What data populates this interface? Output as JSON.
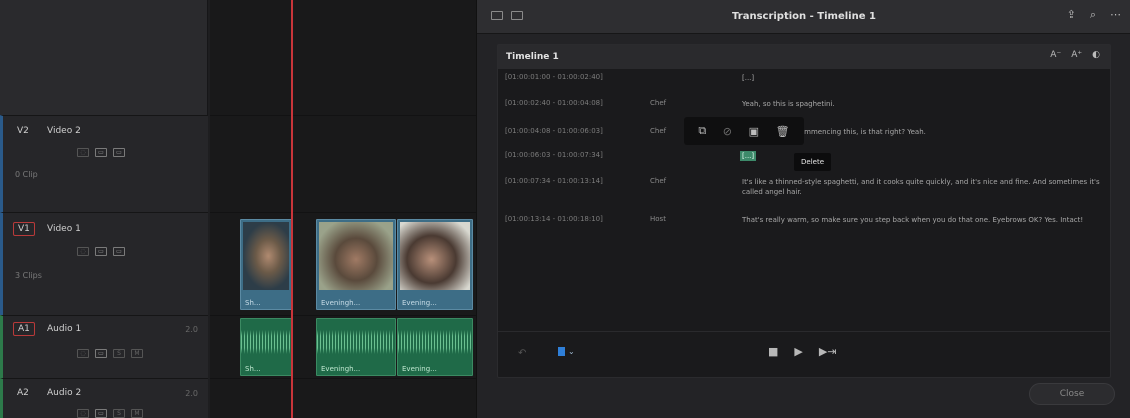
{
  "window": {
    "title": "Transcription - Timeline 1",
    "close_label": "Close"
  },
  "panel": {
    "title": "Timeline 1",
    "icons": [
      "font-smaller-icon",
      "font-larger-icon",
      "contrast-icon"
    ]
  },
  "transcript": [
    {
      "timecode": "[01:00:01:00 - 01:00:02:40]",
      "speaker": "",
      "text": "[...]",
      "highlighted": false
    },
    {
      "timecode": "[01:00:02:40 - 01:00:04:08]",
      "speaker": "Chef",
      "text": "Yeah, so this is spaghetini.",
      "highlighted": false
    },
    {
      "timecode": "[01:00:04:08 - 01:00:06:03]",
      "speaker": "Chef",
      "text": "commencing this, is that right? Yeah.",
      "highlighted": false
    },
    {
      "timecode": "[01:00:06:03 - 01:00:07:34]",
      "speaker": "",
      "text": "[...]",
      "highlighted": true
    },
    {
      "timecode": "[01:00:07:34 - 01:00:13:14]",
      "speaker": "Chef",
      "text": "It's like a thinned-style spaghetti, and it cooks quite quickly, and it's nice and fine. And sometimes it's called angel hair.",
      "highlighted": false
    },
    {
      "timecode": "[01:00:13:14 - 01:00:18:10]",
      "speaker": "Host",
      "text": "That's really warm, so make sure you step back when you do that one. Eyebrows OK? Yes. Intact!",
      "highlighted": false
    }
  ],
  "tooltip": "Delete",
  "floating_toolbar": [
    "copy-icon",
    "link-icon",
    "camera-icon",
    "trash-icon"
  ],
  "tracks": [
    {
      "tag": "V2",
      "name": "Video 2",
      "clips_label": "0 Clip",
      "kind": "video",
      "num": ""
    },
    {
      "tag": "V1",
      "name": "Video 1",
      "clips_label": "3 Clips",
      "kind": "video",
      "num": ""
    },
    {
      "tag": "A1",
      "name": "Audio 1",
      "clips_label": "",
      "kind": "audio",
      "num": "2.0"
    },
    {
      "tag": "A2",
      "name": "Audio 2",
      "clips_label": "",
      "kind": "audio",
      "num": "2.0"
    }
  ],
  "clips": {
    "video": [
      "Sh...",
      "Eveningh...",
      "Evening..."
    ],
    "audio": [
      "Sh...",
      "Eveningh...",
      "Evening..."
    ]
  },
  "colors": {
    "playhead": "#c8353a",
    "video_clip": "#3d6d86",
    "audio_clip": "#1f6a48",
    "highlight": "#3d8a6a",
    "clip_color_swatch": "#2f7fd8"
  }
}
